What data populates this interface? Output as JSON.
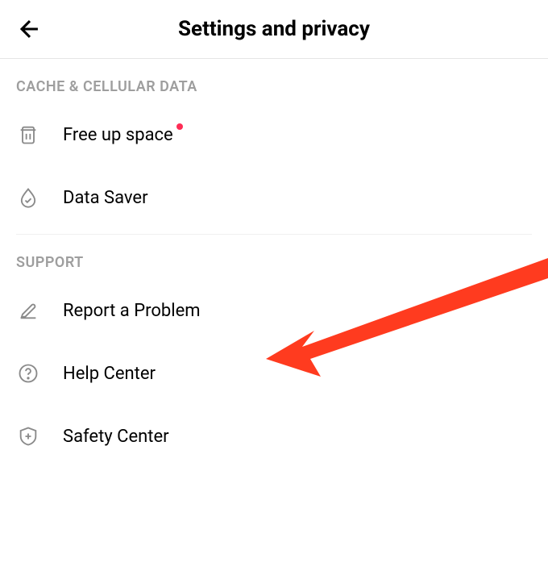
{
  "header": {
    "title": "Settings and privacy"
  },
  "sections": [
    {
      "title": "CACHE & CELLULAR DATA",
      "items": [
        {
          "label": "Free up space",
          "icon": "trash-icon",
          "badge": true
        },
        {
          "label": "Data Saver",
          "icon": "droplet-icon",
          "badge": false
        }
      ]
    },
    {
      "title": "SUPPORT",
      "items": [
        {
          "label": "Report a Problem",
          "icon": "edit-icon",
          "badge": false
        },
        {
          "label": "Help Center",
          "icon": "question-icon",
          "badge": false
        },
        {
          "label": "Safety Center",
          "icon": "shield-plus-icon",
          "badge": false
        }
      ]
    }
  ],
  "annotation": {
    "arrow_color": "#ff3b1f"
  }
}
